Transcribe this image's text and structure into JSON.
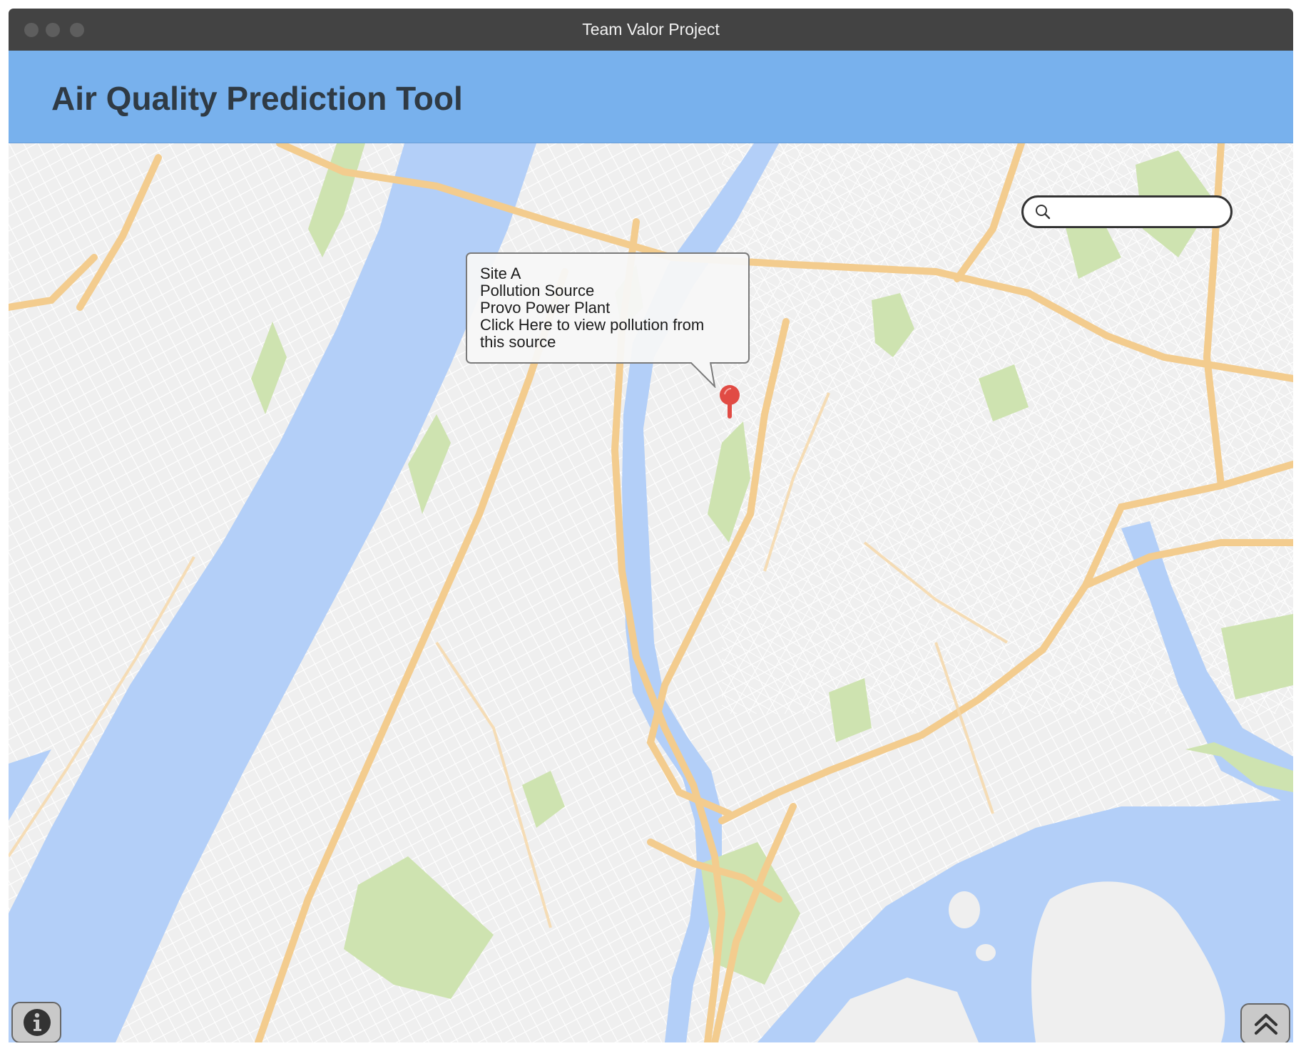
{
  "window": {
    "title": "Team Valor Project"
  },
  "header": {
    "app_title": "Air Quality Prediction Tool"
  },
  "search": {
    "placeholder": "",
    "value": "",
    "icon": "search-icon"
  },
  "marker": {
    "icon": "map-pin-icon",
    "color": "#e14b44"
  },
  "callout": {
    "lines": [
      "Site A",
      "Pollution Source",
      "Provo Power Plant",
      "Click Here to view pollution from",
      "this source"
    ]
  },
  "buttons": {
    "info_icon": "info-icon",
    "scroll_top_icon": "chevron-double-up-icon"
  },
  "colors": {
    "titlebar": "#434343",
    "header": "#78b1ed",
    "water": "#a9c9f7",
    "park": "#c8e0a6",
    "highway": "#f2c57f",
    "land": "#ededed"
  }
}
